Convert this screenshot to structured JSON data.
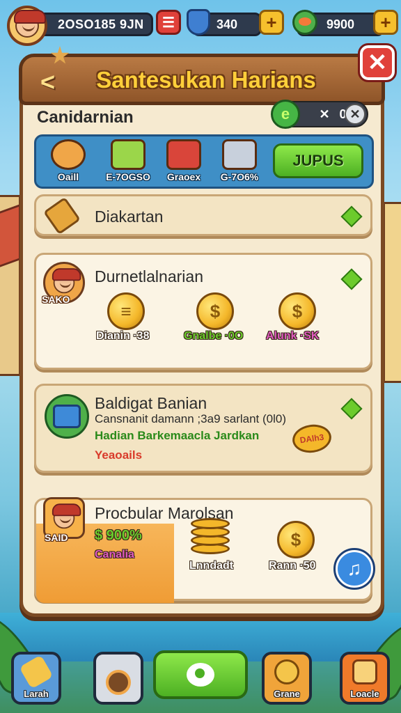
{
  "hud": {
    "player_name": "2OSO185 9JN",
    "gems": "340",
    "coins": "9900",
    "plus": "+"
  },
  "panel": {
    "title": "Santesukan Harians",
    "back": "<",
    "close": "✕",
    "sub_label": "Canidarnian",
    "energy_value": "0",
    "energy_x": "✕"
  },
  "strip": {
    "items": [
      {
        "label": "Oaill",
        "icon": "character-icon"
      },
      {
        "label": "E-7OGSO",
        "icon": "leaf-gem-icon"
      },
      {
        "label": "Graoex",
        "icon": "chest-icon"
      },
      {
        "label": "G-7O6%",
        "icon": "crate-icon"
      }
    ],
    "join_label": "JUPUS"
  },
  "cards": [
    {
      "title": "Diakartan",
      "icon": "scroll-icon"
    },
    {
      "title": "Durnetlalnarian",
      "tag": "SAKO",
      "rewards": [
        {
          "label": "Dianin ·38",
          "color": "#ffffff",
          "accent": "#b13aa0"
        },
        {
          "label": "Gnalbe ·0O",
          "color": "#6ccb2c",
          "accent": "#b13aa0"
        },
        {
          "label": "Alunk ·SK",
          "color": "#e05ac0",
          "accent": "#b13aa0"
        }
      ]
    },
    {
      "title": "Baldigat Banian",
      "line1": "Cansnanit damann ;3a9 sarlant (0l0)",
      "line2": "Hadian Barkemaacla Jardkan",
      "line3": "Yeaoails",
      "ticket": "DAlh3"
    },
    {
      "title": "Procbular Marolsan",
      "tag": "SAID",
      "percent": "$ 900%",
      "sub": "Canalia",
      "rewards": [
        {
          "label": "Lnndadt"
        },
        {
          "label": "Rann ·50"
        }
      ]
    }
  ],
  "nav": [
    {
      "label": "Larah",
      "icon": "pencil-icon",
      "bg": "#5a9ad8"
    },
    {
      "label": "",
      "icon": "camera-icon",
      "bg": "#d9dde4"
    },
    {
      "label": "",
      "icon": "chat-icon",
      "bg": "#6ccb2c"
    },
    {
      "label": "Grane",
      "icon": "coin-icon",
      "bg": "#f0a43a"
    },
    {
      "label": "Loacle",
      "icon": "map-icon",
      "bg": "#f07a2a"
    }
  ],
  "colors": {
    "accent_green": "#6ccb2c",
    "wood": "#7b4a24",
    "panel_bg": "#f6ead0",
    "title_gold": "#ffcf3a"
  }
}
